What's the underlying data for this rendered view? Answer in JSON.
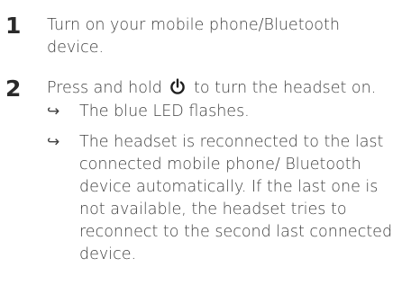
{
  "steps": [
    {
      "number": "1",
      "text": "Turn on your mobile phone/Bluetooth device."
    },
    {
      "number": "2",
      "text_before_icon": "Press and hold",
      "icon": "power-icon",
      "text_after_icon": "to turn the headset on.",
      "results": [
        "The blue LED flashes.",
        "The headset is reconnected to the last connected mobile phone/ Bluetooth device automatically. If the last one is not available, the headset tries to reconnect to the second last connected device."
      ]
    }
  ],
  "arrow_glyph": "↪"
}
